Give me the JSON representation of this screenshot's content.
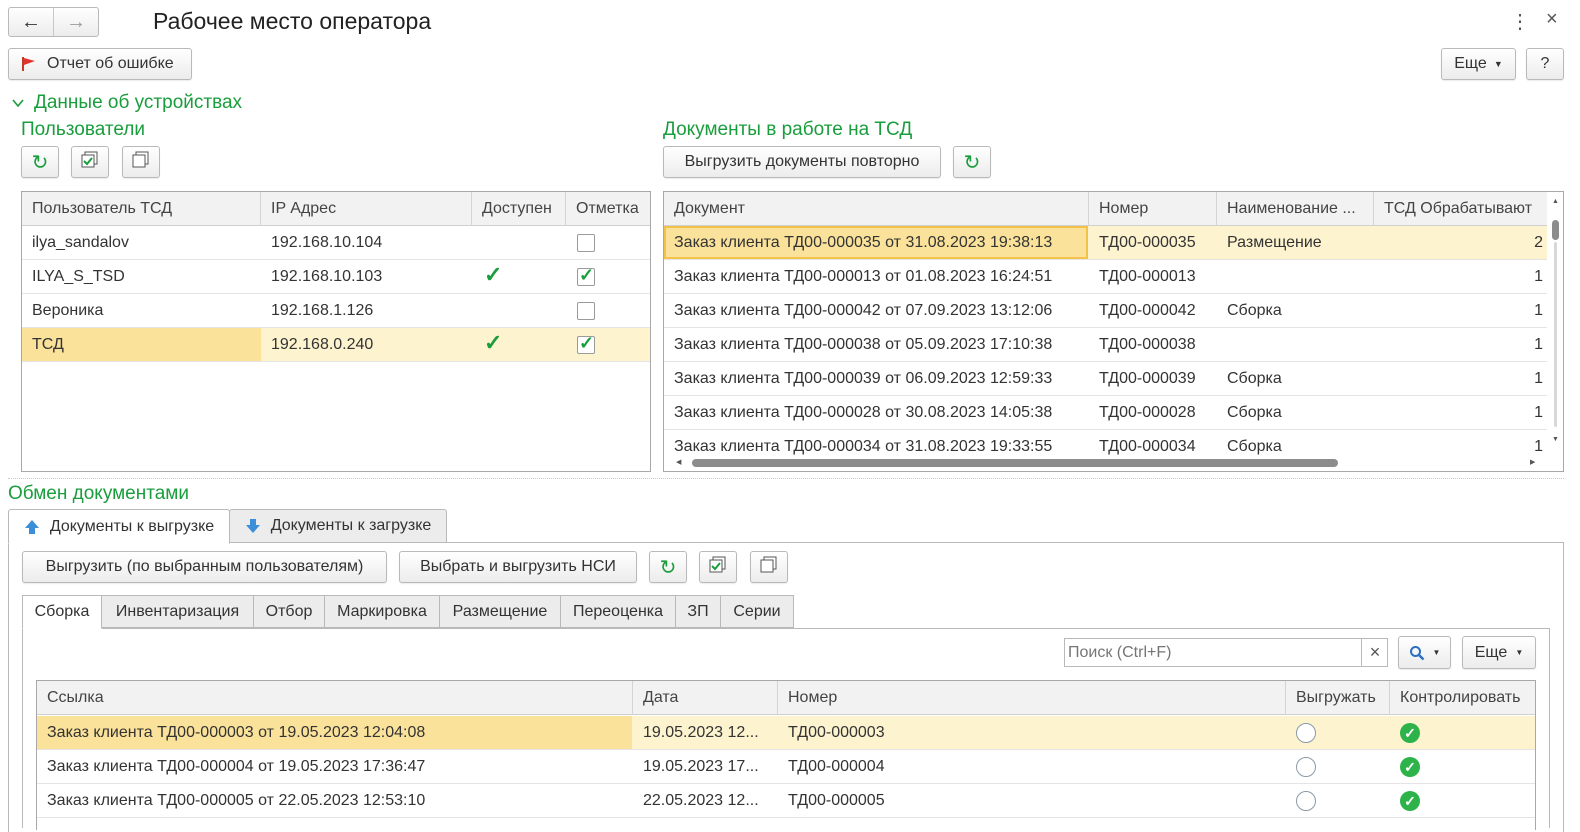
{
  "window": {
    "title": "Рабочее место оператора",
    "more_btn": "Еще",
    "help_btn": "?",
    "error_report_btn": "Отчет об ошибке"
  },
  "devices": {
    "group_title": "Данные об устройствах",
    "users": {
      "title": "Пользователи",
      "columns": [
        "Пользователь ТСД",
        "IP Адрес",
        "Доступен",
        "Отметка"
      ],
      "rows": [
        {
          "user": "ilya_sandalov",
          "ip": "192.168.10.104",
          "available": false,
          "mark": false
        },
        {
          "user": "ILYA_S_TSD",
          "ip": "192.168.10.103",
          "available": true,
          "mark": true
        },
        {
          "user": "Вероника",
          "ip": "192.168.1.126",
          "available": false,
          "mark": false
        },
        {
          "user": "ТСД",
          "ip": "192.168.0.240",
          "available": true,
          "mark": true
        }
      ]
    },
    "docs": {
      "title": "Документы в работе на ТСД",
      "reupload_btn": "Выгрузить документы повторно",
      "columns": [
        "Документ",
        "Номер",
        "Наименование ...",
        "ТСД Обрабатывают"
      ],
      "rows": [
        {
          "doc": "Заказ клиента ТД00-000035 от 31.08.2023 19:38:13",
          "num": "ТД00-000035",
          "name": "Размещение",
          "count": "2"
        },
        {
          "doc": "Заказ клиента ТД00-000013 от 01.08.2023 16:24:51",
          "num": "ТД00-000013",
          "name": "",
          "count": "1"
        },
        {
          "doc": "Заказ клиента ТД00-000042 от 07.09.2023 13:12:06",
          "num": "ТД00-000042",
          "name": "Сборка",
          "count": "1"
        },
        {
          "doc": "Заказ клиента ТД00-000038 от 05.09.2023 17:10:38",
          "num": "ТД00-000038",
          "name": "",
          "count": "1"
        },
        {
          "doc": "Заказ клиента ТД00-000039 от 06.09.2023 12:59:33",
          "num": "ТД00-000039",
          "name": "Сборка",
          "count": "1"
        },
        {
          "doc": "Заказ клиента ТД00-000028 от 30.08.2023 14:05:38",
          "num": "ТД00-000028",
          "name": "Сборка",
          "count": "1"
        },
        {
          "doc": "Заказ клиента ТД00-000034 от 31.08.2023 19:33:55",
          "num": "ТД00-000034",
          "name": "Сборка",
          "count": "1"
        }
      ]
    }
  },
  "exchange": {
    "group_title": "Обмен документами",
    "tabs": [
      "Документы к выгрузке",
      "Документы к загрузке"
    ],
    "upload_selected_btn": "Выгрузить (по выбранным пользователям)",
    "select_upload_nsi_btn": "Выбрать и выгрузить НСИ",
    "subtabs": [
      "Сборка",
      "Инвентаризация",
      "Отбор",
      "Маркировка",
      "Размещение",
      "Переоценка",
      "ЗП",
      "Серии"
    ],
    "search_placeholder": "Поиск (Ctrl+F)",
    "more_btn": "Еще",
    "columns": [
      "Ссылка",
      "Дата",
      "Номер",
      "Выгружать",
      "Контролировать"
    ],
    "rows": [
      {
        "link": "Заказ клиента ТД00-000003 от 19.05.2023 12:04:08",
        "date": "19.05.2023 12...",
        "num": "ТД00-000003",
        "upload": false,
        "control": true
      },
      {
        "link": "Заказ клиента ТД00-000004 от 19.05.2023 17:36:47",
        "date": "19.05.2023 17...",
        "num": "ТД00-000004",
        "upload": false,
        "control": true
      },
      {
        "link": "Заказ клиента ТД00-000005 от 22.05.2023 12:53:10",
        "date": "22.05.2023 12...",
        "num": "ТД00-000005",
        "upload": false,
        "control": true
      }
    ]
  },
  "colors": {
    "accent_green": "#1a9d3c",
    "selection": "#fae29a",
    "selected_row": "#fdf3cf"
  }
}
